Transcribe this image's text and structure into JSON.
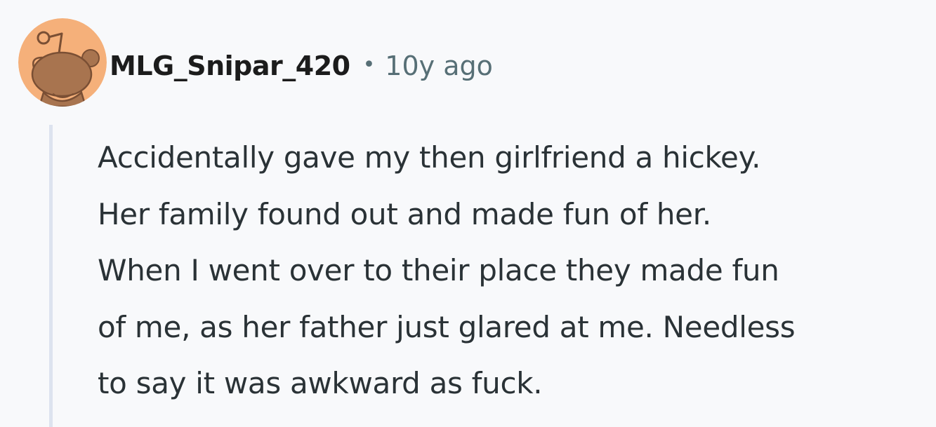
{
  "comment": {
    "author": "MLG_Snipar_420",
    "separator": "•",
    "timestamp": "10y ago",
    "avatar_icon": "reddit-snoo-avatar-icon",
    "body_lines": [
      "Accidentally gave my then girlfriend a hickey.",
      "Her family found out and made fun of her.",
      "When I went over to their place they made fun",
      "of me, as her father just glared at me. Needless",
      "to say it was awkward as fuck."
    ]
  },
  "colors": {
    "background": "#f8f9fb",
    "avatar_bg": "#f5b07a",
    "avatar_figure": "#a8744f",
    "meta_text": "#576f76",
    "thread_line": "#dde3ef"
  }
}
